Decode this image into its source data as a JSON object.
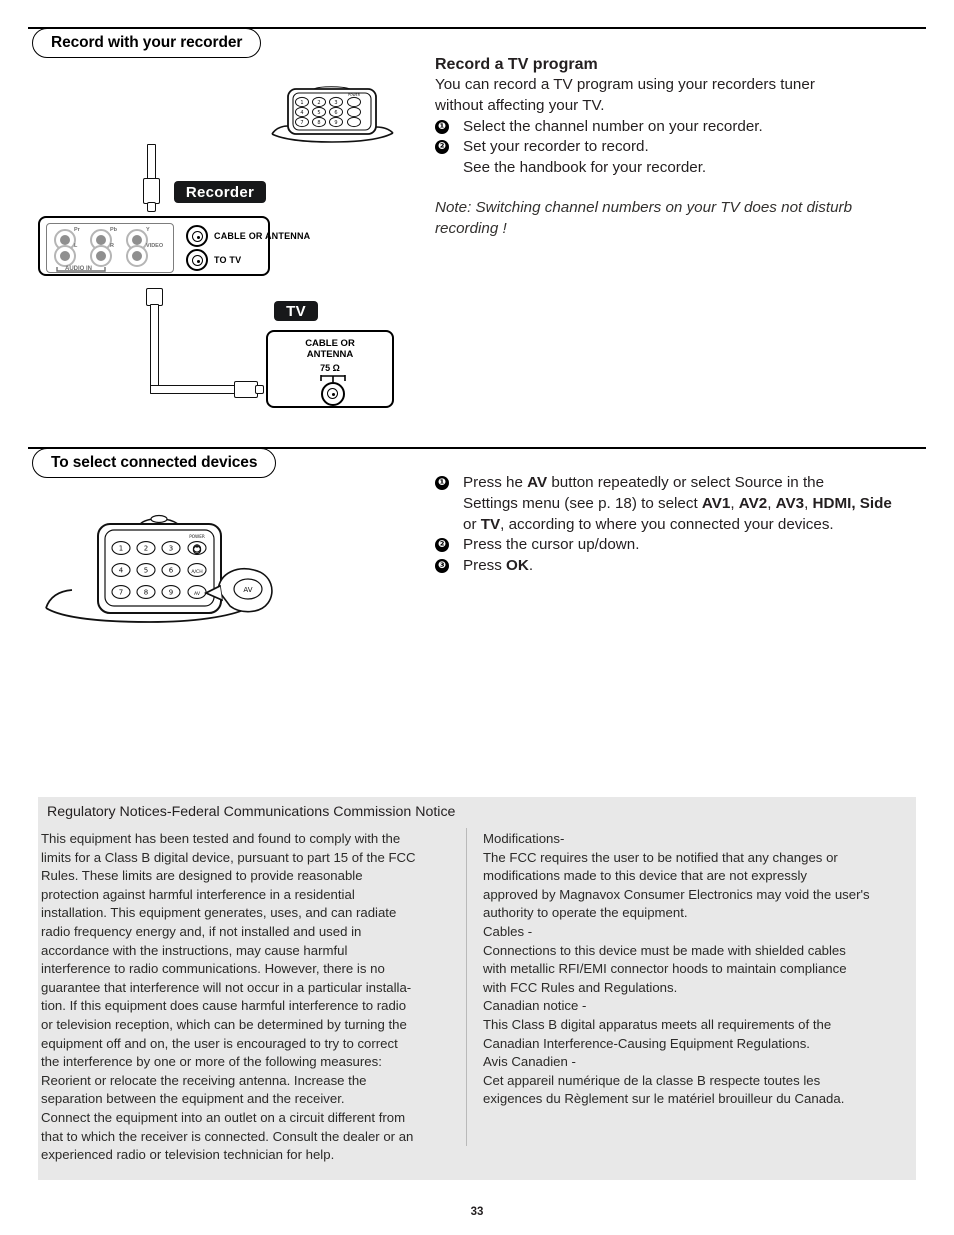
{
  "page": {
    "number": "33"
  },
  "sections": [
    {
      "pill_label": "Record with your recorder",
      "heading": "Record a TV program",
      "intro": [
        "You can record a TV program using your recorders tuner",
        "without affecting your TV."
      ],
      "steps": [
        {
          "num": "❶",
          "text": "Select the channel number on your recorder."
        },
        {
          "num": "❷",
          "text": "Set your recorder to record."
        }
      ],
      "continuation": "See the handbook for your recorder.",
      "note": [
        "Note: Switching channel numbers on your TV does not disturb",
        "recording !"
      ]
    },
    {
      "pill_label": "To select connected devices",
      "steps": [
        {
          "num": "❶",
          "line1_a": "Press he ",
          "line1_b": "AV",
          "line1_c": " button repeatedly or select Source in the",
          "line2_a": "Settings menu (see p. 18) to select ",
          "line2_b": "AV1",
          "line2_c": ", ",
          "line2_d": "AV2",
          "line2_e": ", ",
          "line2_f": "AV3",
          "line2_g": ", ",
          "line2_h": "HDMI, Side",
          "line3_a": "or ",
          "line3_b": "TV",
          "line3_c": ", according to where you connected your devices."
        },
        {
          "num": "❷",
          "text": "Press the cursor up/down."
        },
        {
          "num": "❸",
          "text_a": "Press ",
          "text_b": "OK",
          "text_c": "."
        }
      ]
    }
  ],
  "diagram": {
    "recorder_label": "Recorder",
    "tv_label": "TV",
    "recorder_panel": {
      "audio_in_label": "AUDIO IN",
      "video_label": "VIDEO",
      "rca_labels_top": [
        "Pr",
        "Pb",
        "Y"
      ],
      "rca_labels_bottom": [
        "L",
        "R"
      ],
      "coax_jacks": [
        {
          "label": "CABLE OR ANTENNA"
        },
        {
          "label": "TO TV"
        }
      ]
    },
    "tv_panel": {
      "jack_label_line1": "CABLE OR",
      "jack_label_line2": "ANTENNA",
      "impedance": "75 Ω"
    },
    "remote_top": {
      "keys": [
        "1",
        "2",
        "3",
        "⏻",
        "4",
        "5",
        "6",
        "—",
        "7",
        "8",
        "9",
        "⊙"
      ],
      "power_label": "POWER"
    },
    "remote_bottom": {
      "power_label": "POWER",
      "keys": [
        "1",
        "2",
        "3",
        "⏻",
        "4",
        "5",
        "6",
        "A/CH",
        "7",
        "8",
        "9",
        "AV"
      ],
      "callout_label": "AV"
    }
  },
  "fcc": {
    "title": "Regulatory Notices-Federal Communications Commission Notice",
    "left_column": [
      "This equipment has been tested and found to comply with the",
      "limits for a Class B digital device, pursuant to part 15 of the FCC",
      "Rules. These limits are designed to provide reasonable",
      "protection against harmful interference in a residential",
      "installation. This equipment generates, uses, and can radiate",
      "radio frequency energy and, if not installed and used in",
      "accordance with the instructions, may cause harmful",
      "interference to radio communications. However, there is no",
      "guarantee that interference will not occur in a particular installa-",
      "tion. If this equipment does cause harmful interference to radio",
      "or television reception, which can be determined by turning the",
      "equipment off and on, the user is encouraged to try to correct",
      "the interference by one or more of the following measures:",
      "Reorient or relocate the receiving antenna. Increase the",
      "separation between the equipment and the receiver.",
      "Connect the equipment into an outlet on a circuit different from",
      "that to which the receiver is connected. Consult the dealer or an",
      "experienced radio or television technician for help."
    ],
    "right_column": [
      "Modifications-",
      "The FCC requires the user to be notified that any changes or",
      "modifications made to this device that are not expressly",
      "approved by Magnavox Consumer Electronics may void the user's",
      "authority to operate the equipment.",
      "Cables -",
      "Connections to this device must be made with shielded cables",
      "with metallic RFI/EMI connector hoods to maintain compliance",
      "with FCC Rules and Regulations.",
      "Canadian notice -",
      "This Class B digital apparatus meets all requirements of the",
      "Canadian Interference-Causing Equipment Regulations.",
      "Avis Canadien -",
      "Cet appareil numérique de la classe B respecte toutes les",
      "exigences du Règlement sur le matériel brouilleur du Canada."
    ]
  },
  "colors": {
    "fcc_background": "#e8e8e8",
    "label_background": "#17181a",
    "text": "#231f20"
  }
}
